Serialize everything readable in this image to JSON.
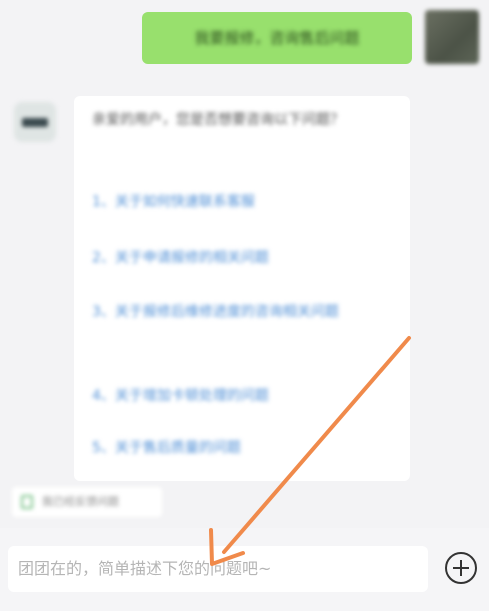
{
  "conversation": {
    "user_message": "我要报修，咨询售后问题",
    "bot_greeting": "亲爱的用户，您是否想要咨询以下问题？",
    "faq_items": [
      "1、关于如何快速联系客服",
      "2、关于申请报修的相关问题",
      "3、关于报修后维修进度的咨询相关问题",
      "4、关于增加卡顿处理的问题",
      "5、关于售后质量的问题"
    ],
    "feedback_chip": "我已经反馈问题"
  },
  "composer": {
    "placeholder": "团团在的，简单描述下您的问题吧~"
  },
  "annotation": {
    "arrow_color": "#f08a4b"
  }
}
